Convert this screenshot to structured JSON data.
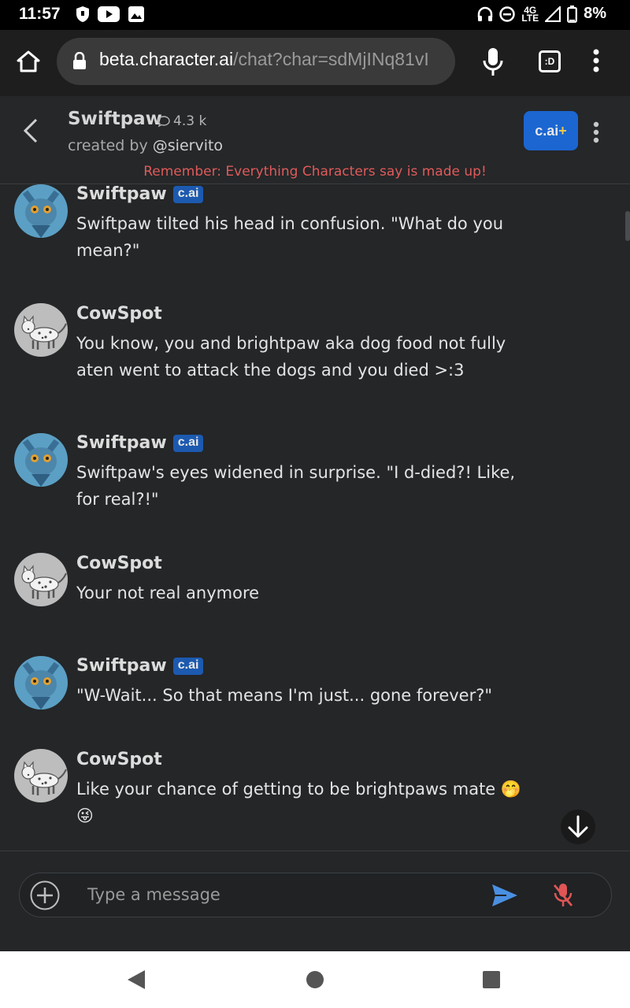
{
  "status_bar": {
    "time": "11:57",
    "battery": "8%",
    "network": "4G LTE"
  },
  "browser": {
    "url_domain": "beta.character.ai",
    "url_path": "/chat?char=sdMjINq81vI",
    "tabs_label": ":D"
  },
  "header": {
    "character_name": "Swiftpaw",
    "chat_count": "4.3 k",
    "created_by_prefix": "created by ",
    "creator_handle": "@siervito",
    "plus_button_label": "c.ai",
    "plus_symbol": "+",
    "disclaimer": "Remember: Everything Characters say is made up!"
  },
  "messages": [
    {
      "author": "Swiftpaw",
      "is_bot": true,
      "badge": "c.ai",
      "text": "Swiftpaw tilted his head in confusion. \"What do you mean?\""
    },
    {
      "author": "CowSpot",
      "is_bot": false,
      "text": "You know, you and brightpaw aka dog food not fully aten went to attack the dogs and you died >:3"
    },
    {
      "author": "Swiftpaw",
      "is_bot": true,
      "badge": "c.ai",
      "text": "Swiftpaw's eyes widened in surprise. \"I d-died?! Like, for real?!\""
    },
    {
      "author": "CowSpot",
      "is_bot": false,
      "text": "Your not real anymore"
    },
    {
      "author": "Swiftpaw",
      "is_bot": true,
      "badge": "c.ai",
      "text": "\"W-Wait... So that means I'm just... gone forever?\""
    },
    {
      "author": "CowSpot",
      "is_bot": false,
      "text": "Like your chance of getting to be brightpaws mate 🤭 😜"
    }
  ],
  "composer": {
    "placeholder": "Type a message"
  },
  "colors": {
    "accent_blue": "#1b66d1",
    "badge_blue": "#1c5ab0",
    "disclaimer_red": "#e05a5a",
    "send_blue": "#4a90e2",
    "mic_off_red": "#e05555"
  }
}
